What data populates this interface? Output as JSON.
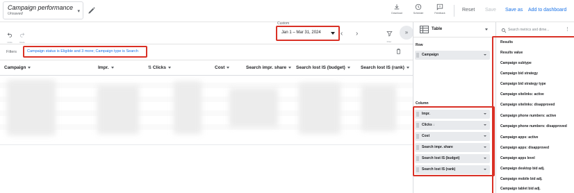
{
  "report": {
    "title": "Campaign performance",
    "status": "Unsaved"
  },
  "toolbar": {
    "download": "Download",
    "schedule": "Schedule",
    "feedback": "Feedback",
    "reset": "Reset",
    "save": "Save",
    "save_as": "Save as",
    "add_to_dashboard": "Add to dashboard"
  },
  "toolbar2": {
    "undo": "Undo",
    "redo": "Redo",
    "date_label": "Custom",
    "date_range": "Jan 1 – Mar 31, 2024",
    "filter": "Filter"
  },
  "filters": {
    "label": "Filters",
    "value": "Campaign status is Eligible and 3 more; Campaign type is Search"
  },
  "table": {
    "columns": [
      "Campaign",
      "Impr.",
      "Clicks",
      "Cost",
      "Search impr. share",
      "Search lost IS (budget)",
      "Search lost IS (rank)"
    ]
  },
  "editor": {
    "visualization": "Table",
    "row_label": "Row",
    "rows": [
      "Campaign"
    ],
    "column_label": "Column",
    "columns": [
      "Impr.",
      "Clicks",
      "Cost",
      "Search impr. share",
      "Search lost IS (budget)",
      "Search lost IS (rank)"
    ]
  },
  "metrics": {
    "search_placeholder": "Search metrics and dime...",
    "items": [
      "Results",
      "Results value",
      "Campaign subtype",
      "Campaign bid strategy",
      "Campaign bid strategy type",
      "Campaign sitelinks: active",
      "Campaign sitelinks: disapproved",
      "Campaign phone numbers: active",
      "Campaign phone numbers: disapproved",
      "Campaign apps: active",
      "Campaign apps: disapproved",
      "Campaign apps level",
      "Campaign desktop bid adj.",
      "Campaign mobile bid adj.",
      "Campaign tablet bid adj."
    ]
  },
  "colors": {
    "accent": "#1a73e8",
    "highlight": "#d93025"
  }
}
